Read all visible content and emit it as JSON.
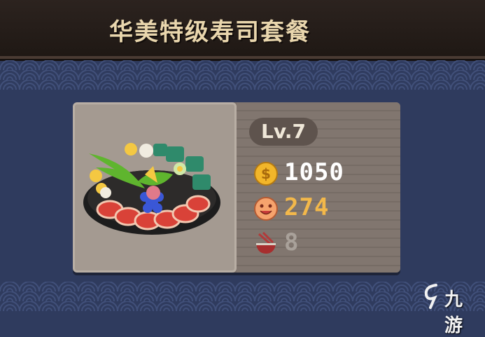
{
  "dish": {
    "name": "华美特级寿司套餐",
    "level": "Lv.7",
    "stats": {
      "price": "1050",
      "satisfaction": "274",
      "servings": "8"
    }
  },
  "watermark": {
    "text": "九游"
  },
  "colors": {
    "background": "#2f3b5e",
    "title_text": "#e9d6ad",
    "price_text": "#ffffff",
    "satisfaction_text": "#f3b84a",
    "servings_text": "#a9a19a",
    "coin": "#f2b62a"
  },
  "icons": {
    "price": "gold-coin-icon",
    "satisfaction": "happy-face-icon",
    "servings": "bowl-chopsticks-icon"
  }
}
